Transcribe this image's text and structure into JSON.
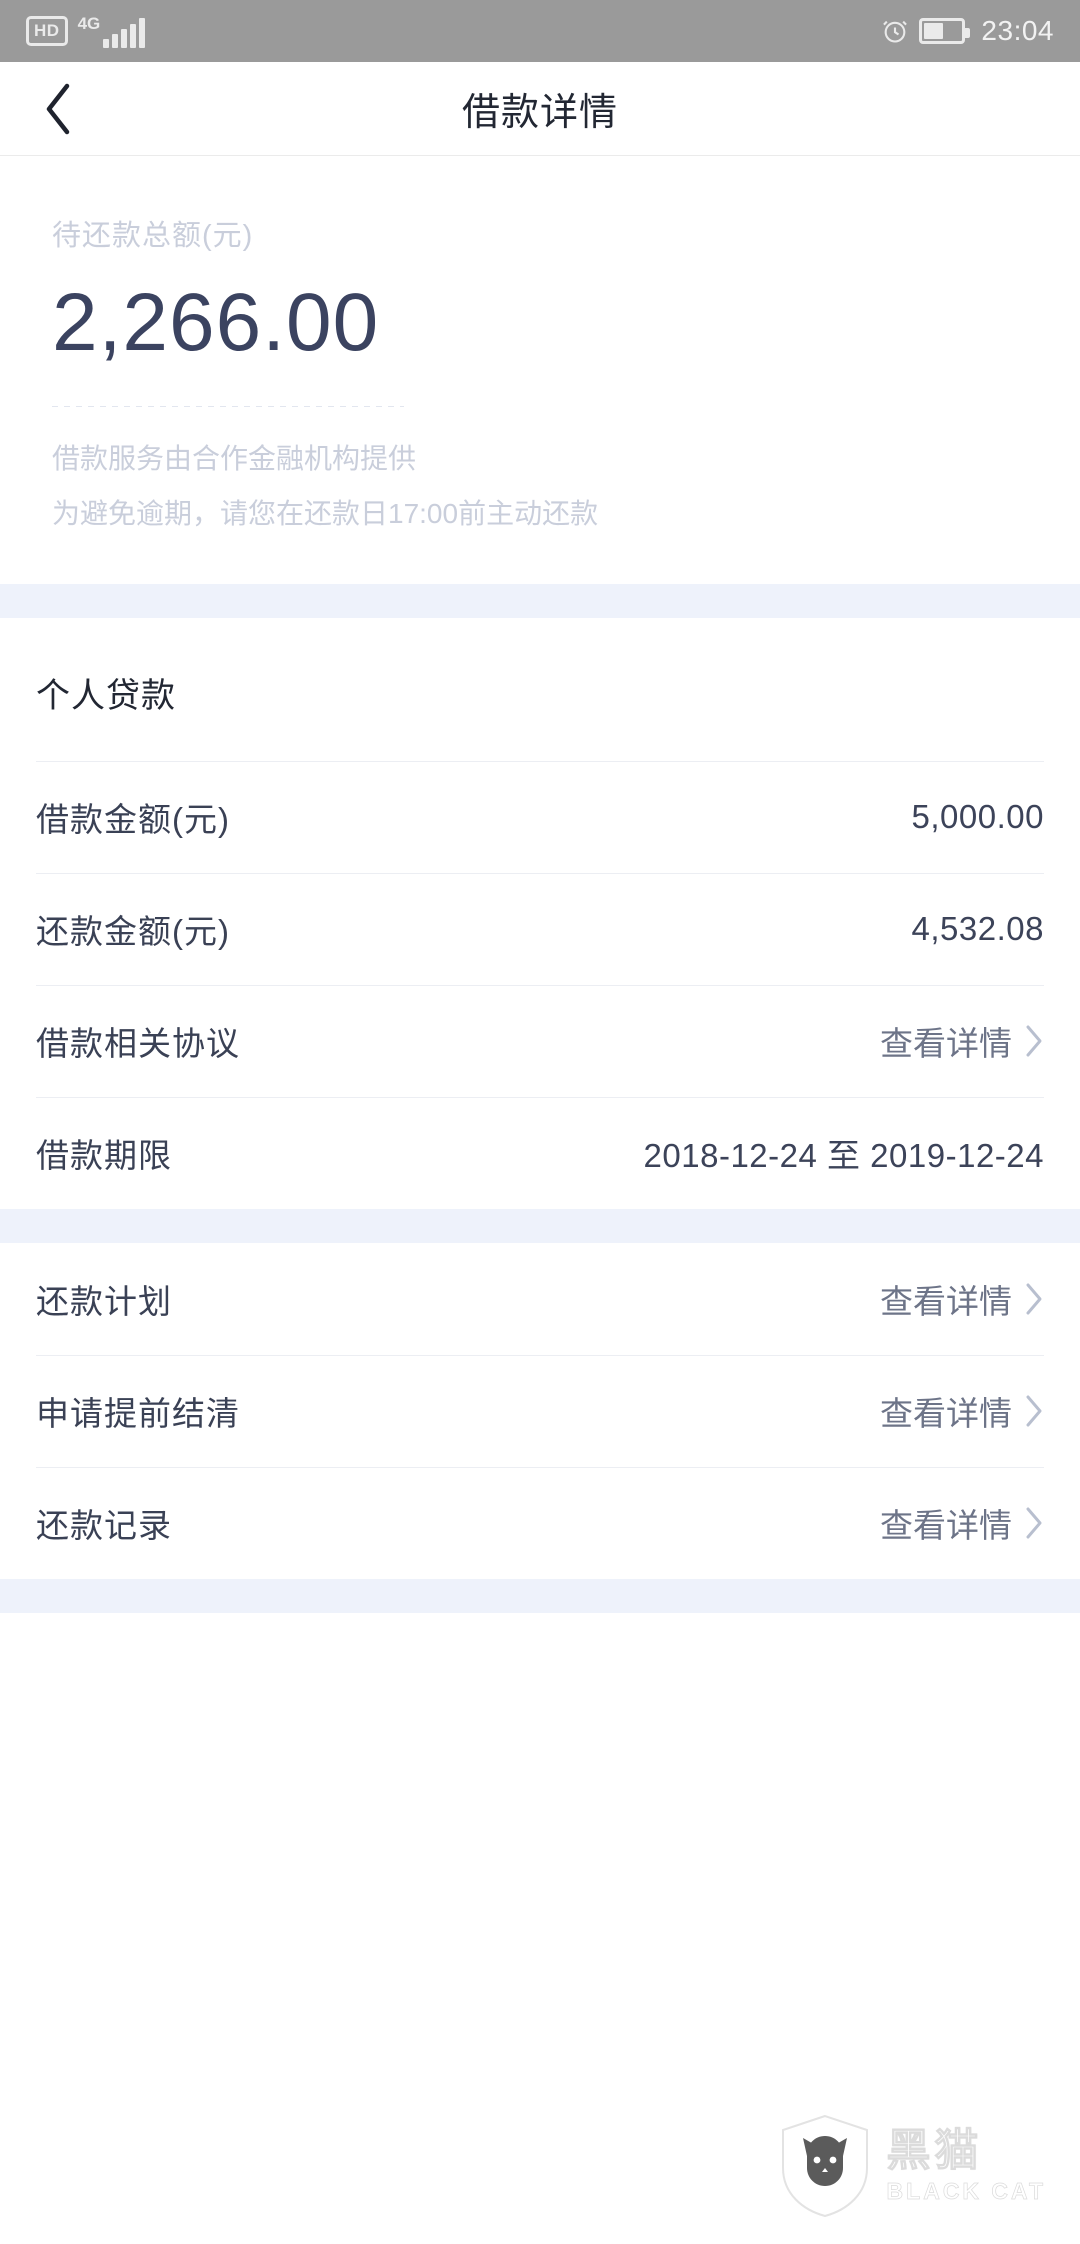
{
  "status_bar": {
    "hd_label": "HD",
    "network_label": "4G",
    "signal_bars": 5,
    "alarm_icon": "alarm-clock-icon",
    "battery_level_percent": 52,
    "time": "23:04"
  },
  "nav": {
    "back_icon": "chevron-left-icon",
    "title": "借款详情"
  },
  "summary": {
    "label": "待还款总额(元)",
    "amount": "2,266.00",
    "note_line1": "借款服务由合作金融机构提供",
    "note_line2": "为避免逾期，请您在还款日17:00前主动还款"
  },
  "loan_section": {
    "title": "个人贷款",
    "rows": [
      {
        "label": "借款金额(元)",
        "value": "5,000.00",
        "type": "value"
      },
      {
        "label": "还款金额(元)",
        "value": "4,532.08",
        "type": "value"
      },
      {
        "label": "借款相关协议",
        "value": "查看详情",
        "type": "link"
      },
      {
        "label": "借款期限",
        "value": "2018-12-24 至 2019-12-24",
        "type": "value"
      }
    ]
  },
  "actions_section": {
    "rows": [
      {
        "label": "还款计划",
        "value": "查看详情",
        "type": "link"
      },
      {
        "label": "申请提前结清",
        "value": "查看详情",
        "type": "link"
      },
      {
        "label": "还款记录",
        "value": "查看详情",
        "type": "link"
      }
    ]
  },
  "watermark": {
    "cn": "黑猫",
    "en": "BLACK CAT",
    "icon": "black-cat-shield-icon"
  },
  "colors": {
    "accent_navy": "#3b4360",
    "muted": "#c9cedb",
    "band": "#eef2fb",
    "statusbar": "#9a9a9a"
  }
}
